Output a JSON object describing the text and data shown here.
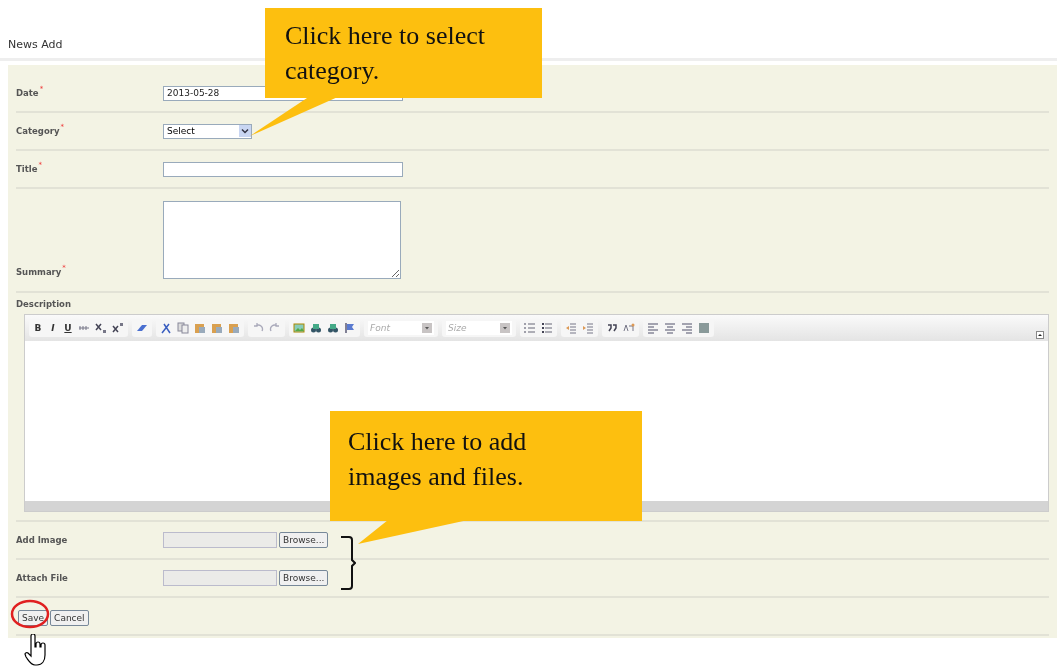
{
  "page": {
    "title": "News Add"
  },
  "fields": [
    {
      "kind": "text",
      "label": "Date",
      "required_mark": "*",
      "value": "2013-05-28"
    },
    {
      "kind": "select",
      "label": "Category",
      "required_mark": "*",
      "value": "Select"
    },
    {
      "kind": "text",
      "label": "Title",
      "required_mark": "*"
    },
    {
      "kind": "textarea",
      "label": "Summary",
      "required_mark": "*"
    }
  ],
  "description": {
    "label": "Description",
    "toolbar": [
      [
        {
          "kind": "bold",
          "text": "B"
        },
        {
          "kind": "italic",
          "text": "I"
        },
        {
          "kind": "underline",
          "text": "U"
        },
        {
          "kind": "strike"
        },
        {
          "kind": "subscript"
        },
        {
          "kind": "superscript"
        }
      ],
      [
        {
          "kind": "eraser"
        }
      ],
      [
        {
          "kind": "cut"
        },
        {
          "kind": "copy"
        },
        {
          "kind": "paste"
        },
        {
          "kind": "paste"
        },
        {
          "kind": "paste"
        }
      ],
      [
        {
          "kind": "undo"
        },
        {
          "kind": "redo"
        }
      ],
      [
        {
          "kind": "image"
        },
        {
          "kind": "binoculars"
        },
        {
          "kind": "binoculars"
        },
        {
          "kind": "flag"
        }
      ],
      [
        {
          "kind": "combo",
          "placeholder": "Font"
        }
      ],
      [
        {
          "kind": "combo",
          "placeholder": "Size"
        }
      ],
      [
        {
          "kind": "numbered-list"
        },
        {
          "kind": "bullet-list"
        }
      ],
      [
        {
          "kind": "outdent"
        },
        {
          "kind": "indent"
        }
      ],
      [
        {
          "kind": "quote"
        },
        {
          "kind": "special"
        }
      ],
      [
        {
          "kind": "align-left"
        },
        {
          "kind": "align-center"
        },
        {
          "kind": "align-right"
        },
        {
          "kind": "justify"
        }
      ]
    ]
  },
  "uploads": [
    {
      "label": "Add Image",
      "button": "Browse..."
    },
    {
      "label": "Attach File",
      "button": "Browse..."
    }
  ],
  "buttons": [
    {
      "label": "Save",
      "highlighted": true
    },
    {
      "label": "Cancel",
      "highlighted": false
    }
  ],
  "callouts": [
    {
      "kind": "category",
      "text": "Click here to select category."
    },
    {
      "kind": "uploads",
      "text": "Click here to add images and files."
    }
  ]
}
